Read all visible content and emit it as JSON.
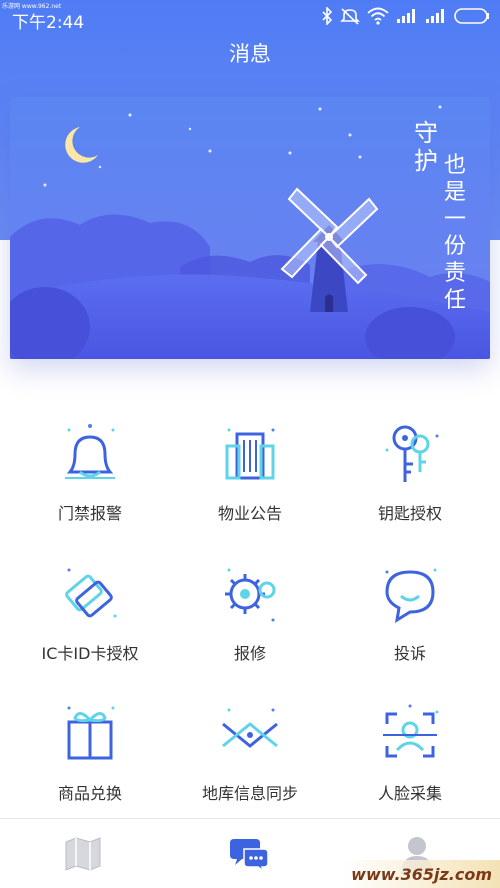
{
  "watermark_top": "乐游网 www.962.net",
  "status": {
    "time": "下午2:44"
  },
  "header": {
    "title": "消息"
  },
  "banner": {
    "line1": "守护",
    "line2": "也是一份责任"
  },
  "grid": [
    {
      "label": "门禁报警",
      "icon": "bell-icon"
    },
    {
      "label": "物业公告",
      "icon": "building-icon"
    },
    {
      "label": "钥匙授权",
      "icon": "key-icon"
    },
    {
      "label": "IC卡ID卡授权",
      "icon": "card-icon"
    },
    {
      "label": "报修",
      "icon": "gear-icon"
    },
    {
      "label": "投诉",
      "icon": "chat-bubble-icon"
    },
    {
      "label": "商品兑换",
      "icon": "gift-icon"
    },
    {
      "label": "地库信息同步",
      "icon": "sync-icon"
    },
    {
      "label": "人脸采集",
      "icon": "face-scan-icon"
    }
  ],
  "tabs": [
    {
      "name": "map-icon",
      "active": false
    },
    {
      "name": "message-icon",
      "active": true
    },
    {
      "name": "profile-icon",
      "active": false
    }
  ],
  "watermark_bottom": "www.365jz.com",
  "colors": {
    "primary": "#4f7cf5",
    "accent_cyan": "#5fd3e8",
    "dark_blue": "#3355cc"
  }
}
